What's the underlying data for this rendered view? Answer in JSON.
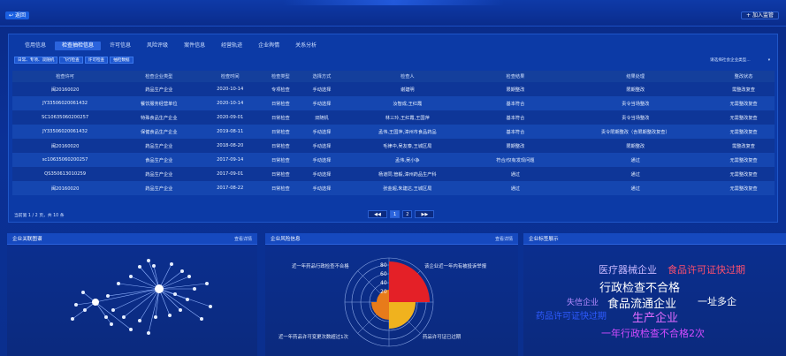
{
  "header": {
    "back_label": "返回",
    "add_watch_label": "加入监管"
  },
  "tabs": [
    "信用信息",
    "检查抽检信息",
    "许可信息",
    "风险评级",
    "案件信息",
    "经营轨迹",
    "企业舆情",
    "关系分析"
  ],
  "active_tab": 1,
  "subtabs": [
    "日常、专项、双随机",
    "飞行检查",
    "许可检查",
    "抽检数据"
  ],
  "filter": {
    "placeholder": "请选择社会企业类型..."
  },
  "table": {
    "headers": [
      "检查许可",
      "检查企业类型",
      "检查时间",
      "检查类型",
      "选择方式",
      "检查人",
      "检查结果",
      "结果处理",
      "整改状态"
    ],
    "rows": [
      [
        "闽20160020",
        "药品生产企业",
        "2020-10-14",
        "专项检查",
        "手动选择",
        "谢建明",
        "限期整改",
        "限期整改",
        "需整改复查"
      ],
      [
        "JY33506020061432",
        "餐饮服务经营单位",
        "2020-10-14",
        "日常检查",
        "手动选择",
        "汝智成,王红霞",
        "基本符合",
        "责令当场整改",
        "无需整改复查"
      ],
      [
        "SC10635060200257",
        "特殊食品生产企业",
        "2020-09-01",
        "日常检查",
        "双随机",
        "林三玲,王红霞,王国萍",
        "基本符合",
        "责令当场整改",
        "无需整改复查"
      ],
      [
        "JY33506020061432",
        "保健食品生产企业",
        "2019-08-11",
        "日常检查",
        "手动选择",
        "孟伟,王国萍,漳州市食品药品",
        "基本符合",
        "责令限期整改（含限期整改复查）",
        "无需整改复查"
      ],
      [
        "闽20160020",
        "药品生产企业",
        "2018-08-20",
        "日常检查",
        "手动选择",
        "毛律中,吴友泰,王城区局",
        "限期整改",
        "限期整改",
        "需整改复查"
      ],
      [
        "sc10635060200257",
        "食品生产企业",
        "2017-09-14",
        "日常检查",
        "手动选择",
        "孟伟,吴小争",
        "符合/仅有发现问题",
        "通过",
        "无需整改复查"
      ],
      [
        "QS350613010259",
        "药品生产企业",
        "2017-09-01",
        "日常检查",
        "手动选择",
        "杨道同,管毅,漳州药品生产科",
        "通过",
        "通过",
        "无需整改复查"
      ],
      [
        "闽20160020",
        "药品生产企业",
        "2017-08-22",
        "日常检查",
        "手动选择",
        "张金超,朱建达,王城区局",
        "通过",
        "通过",
        "无需整改复查"
      ]
    ]
  },
  "pagination": {
    "summary": "当前第 1 / 2 页，共 10 条",
    "prev": "◀◀",
    "pages": [
      "1",
      "2"
    ],
    "next": "▶▶"
  },
  "cards": {
    "relation": {
      "title": "企业关联图谱",
      "more": "查看详情"
    },
    "risk": {
      "title": "企业风险信息",
      "more": "查看详情"
    },
    "tags": {
      "title": "企业标签展示"
    }
  },
  "risk_chart": {
    "ticks": [
      "80",
      "60",
      "40",
      "20"
    ],
    "labels": [
      "近一年药品行政检查不合格",
      "该企业近一年内有被投诉举报",
      "近一年药品许可变更次数超过1次",
      "药品许可证已过期"
    ],
    "colors": [
      "#e42027",
      "#f0b21e",
      "#e87b1a",
      "#e87b1a"
    ]
  },
  "word_cloud": [
    {
      "text": "医疗器械企业",
      "color": "#c8b8ff"
    },
    {
      "text": "食品许可证快过期",
      "color": "#ff4f6d"
    },
    {
      "text": "行政检查不合格",
      "color": "#ffffff"
    },
    {
      "text": "失信企业",
      "color": "#b58bff"
    },
    {
      "text": "食品流通企业",
      "color": "#ffffff"
    },
    {
      "text": "一址多企",
      "color": "#ffffff"
    },
    {
      "text": "药品许可证快过期",
      "color": "#2e5bff"
    },
    {
      "text": "生产企业",
      "color": "#e06bff"
    },
    {
      "text": "一年行政检查不合格2次",
      "color": "#d34bff"
    }
  ]
}
